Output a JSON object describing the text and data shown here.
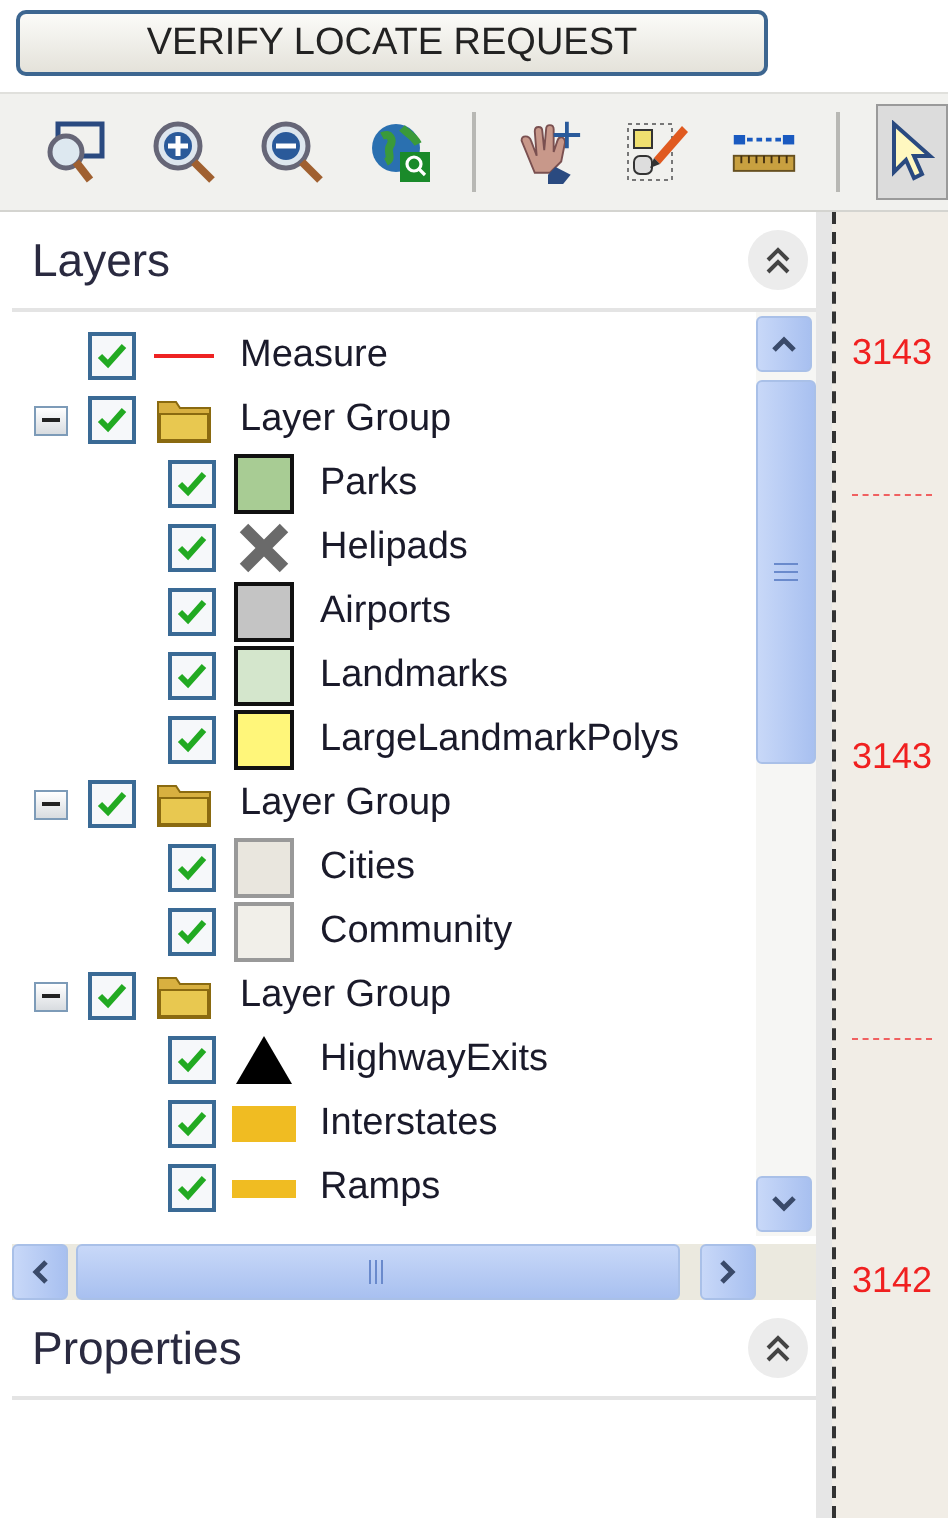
{
  "verify_button": "VERIFY LOCATE REQUEST",
  "toolbar": [
    [
      {
        "kind": "zoom-box",
        "selected": false
      },
      {
        "kind": "zoom-in",
        "selected": false
      },
      {
        "kind": "zoom-out",
        "selected": false
      },
      {
        "kind": "globe",
        "selected": false
      }
    ],
    [
      {
        "kind": "pan",
        "selected": false
      },
      {
        "kind": "edit",
        "selected": false
      },
      {
        "kind": "measure",
        "selected": false
      }
    ],
    [
      {
        "kind": "pointer",
        "selected": true
      }
    ]
  ],
  "layers_panel": {
    "title": "Layers",
    "layers": [
      {
        "label": "Measure",
        "kind": "line",
        "checked": true,
        "color": "#ee2222"
      },
      {
        "label": "Layer Group",
        "kind": "group",
        "checked": true,
        "expanded": true,
        "children": [
          {
            "label": "Parks",
            "kind": "fill",
            "checked": true,
            "color": "#a8cc94"
          },
          {
            "label": "Helipads",
            "kind": "cross",
            "checked": true
          },
          {
            "label": "Airports",
            "kind": "fill",
            "checked": true,
            "color": "#c4c4c4"
          },
          {
            "label": "Landmarks",
            "kind": "fill",
            "checked": true,
            "color": "#d4e6cc"
          },
          {
            "label": "LargeLandmarkPolys",
            "kind": "fill",
            "checked": true,
            "color": "#fff67a"
          }
        ]
      },
      {
        "label": "Layer Group",
        "kind": "group",
        "checked": true,
        "expanded": true,
        "children": [
          {
            "label": "Cities",
            "kind": "light-fill",
            "checked": true,
            "color": "#e9e6de"
          },
          {
            "label": "Community",
            "kind": "light-fill",
            "checked": true,
            "color": "#f1efe9"
          }
        ]
      },
      {
        "label": "Layer Group",
        "kind": "group",
        "checked": true,
        "expanded": true,
        "children": [
          {
            "label": "HighwayExits",
            "kind": "triangle",
            "checked": true
          },
          {
            "label": "Interstates",
            "kind": "thick-bar",
            "checked": true,
            "color": "#f0bc22"
          },
          {
            "label": "Ramps",
            "kind": "bar",
            "checked": true,
            "color": "#f0bc22"
          }
        ]
      }
    ]
  },
  "properties_panel": {
    "title": "Properties"
  },
  "map": {
    "labels": [
      "3143",
      "3143",
      "3142"
    ]
  }
}
